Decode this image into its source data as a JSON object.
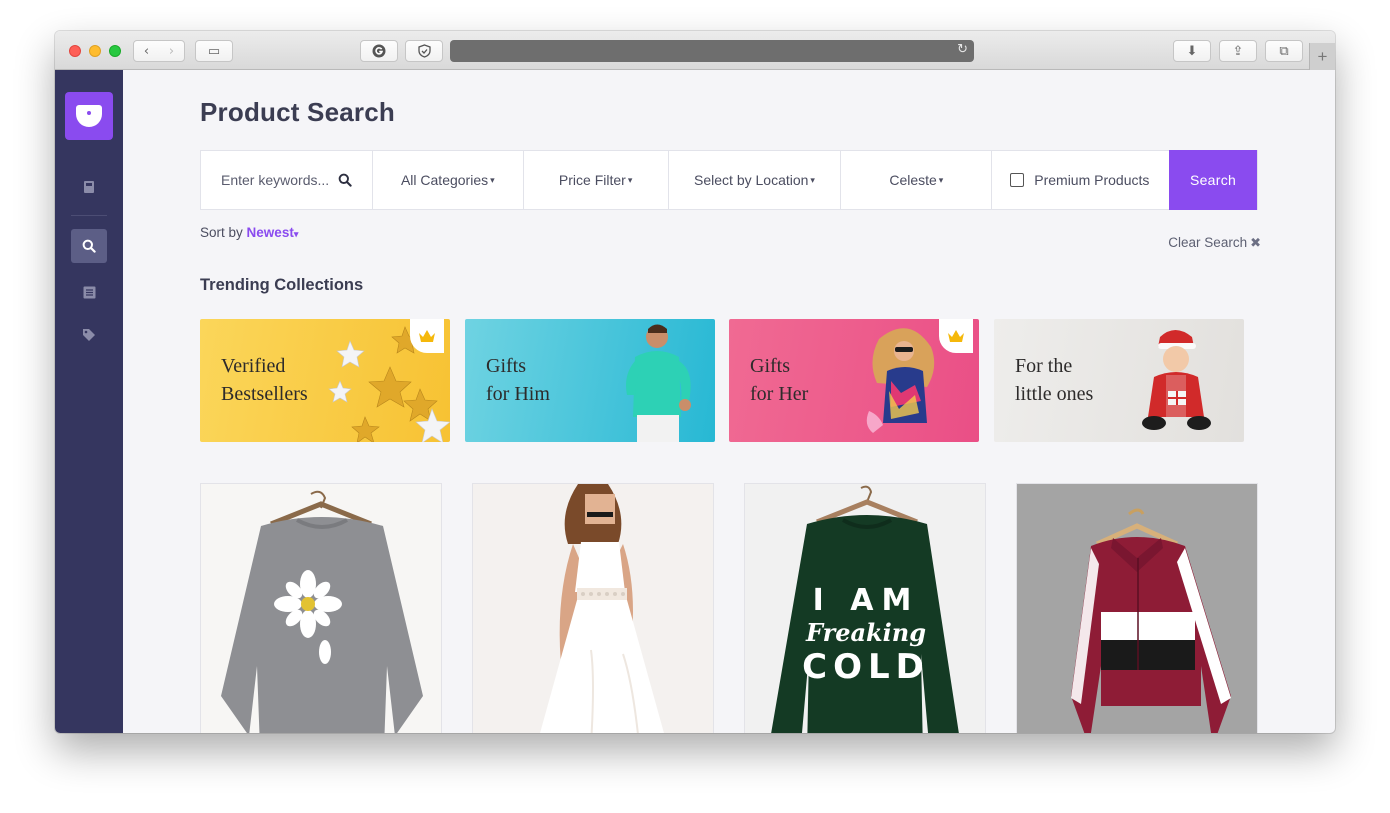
{
  "browser": {
    "controls": {
      "back": "‹",
      "forward": "›",
      "sidebar": "▭",
      "reload": "↻",
      "download": "⬇",
      "share": "⇪",
      "tabs": "⧉",
      "new_tab": "+"
    }
  },
  "sidebar": {
    "icons": [
      {
        "name": "book-icon",
        "glyph": "▮"
      },
      {
        "name": "search-icon",
        "glyph": "🔍︎",
        "active": true
      },
      {
        "name": "list-icon",
        "glyph": "☷"
      },
      {
        "name": "tag-icon",
        "glyph": "◆"
      }
    ]
  },
  "page": {
    "title": "Product Search"
  },
  "search": {
    "keywords_placeholder": "Enter keywords...",
    "categories": "All Categories",
    "price": "Price Filter",
    "location": "Select by Location",
    "user": "Celeste",
    "premium_label": "Premium Products",
    "premium_checked": false,
    "button": "Search",
    "caret": "▾",
    "search_glyph": "⚲"
  },
  "sort": {
    "label": "Sort by",
    "value": "Newest",
    "caret": "▾"
  },
  "clear": {
    "label": "Clear Search",
    "icon": "✖"
  },
  "trending": {
    "title": "Trending Collections",
    "collections": [
      {
        "label": "Verified\nBestsellers",
        "premium": true,
        "theme": "#f9cd47"
      },
      {
        "label": "Gifts\nfor Him",
        "premium": false,
        "theme": "#38c1d8"
      },
      {
        "label": "Gifts\nfor Her",
        "premium": true,
        "theme": "#ef5a8c"
      },
      {
        "label": "For the\nlittle ones",
        "premium": false,
        "theme": "#e8e6e3"
      }
    ]
  },
  "products": [
    {
      "name": "grey-daisy-sweater"
    },
    {
      "name": "white-lace-dress"
    },
    {
      "name": "green-slogan-sweatshirt",
      "print": [
        "I AM",
        "Freaking",
        "COLD"
      ]
    },
    {
      "name": "burgundy-colorblock-jacket"
    }
  ],
  "colors": {
    "accent": "#8a4bef",
    "sidebar": "#35365f"
  }
}
